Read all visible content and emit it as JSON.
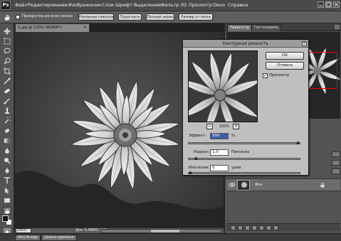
{
  "app": {
    "logo": "Ps",
    "menu": [
      "Файл",
      "Редактирование",
      "Изображение",
      "Слои",
      "Шрифт",
      "Выделение",
      "Фильтр",
      "3D",
      "Просмотр",
      "Окно",
      "Справка"
    ]
  },
  "options_bar": {
    "sample_all_label": "Прокрутка во всех окнах",
    "buttons": [
      "Реальные пикселы",
      "Подогнать",
      "Полный экран",
      "Размер оттиска"
    ]
  },
  "document": {
    "tab_title": "2.jpg @ 100% (RGB/8*)",
    "zoom": "100%",
    "info": "Док: 5,49M/5,49M"
  },
  "bottom_tabs": [
    "Mini Bridge",
    "Шкала времени"
  ],
  "panels": {
    "tabs": [
      "Навигатор",
      "Гистограмма"
    ],
    "layer_name": "Фон"
  },
  "dialog": {
    "title": "Контурная резкость",
    "ok_label": "OK",
    "cancel_label": "Отмена",
    "preview_label": "Просмотр",
    "preview_checked": true,
    "zoom_minus": "−",
    "zoom_plus": "+",
    "zoom_percent": "100%",
    "amount_label": "Эффект:",
    "amount_value": "500",
    "amount_unit": "%",
    "amount_level": 1.0,
    "radius_label": "Радиус:",
    "radius_value": "1,0",
    "radius_unit": "Пикселы",
    "radius_level": 0.05,
    "threshold_label": "Изогелия:",
    "threshold_value": "0",
    "threshold_unit": "уров.",
    "threshold_level": 0.0
  }
}
